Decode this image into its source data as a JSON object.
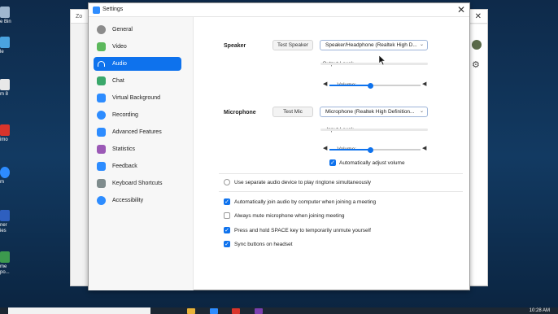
{
  "desktop": {
    "icons": [
      {
        "label": "e Bin"
      },
      {
        "label": "le"
      },
      {
        "label": "m 8"
      },
      {
        "label": "imo"
      },
      {
        "label": "m"
      },
      {
        "label": "ner\nies"
      },
      {
        "label": "me\npo..."
      }
    ]
  },
  "background_window": {
    "title": "Zo"
  },
  "window": {
    "title": "Settings"
  },
  "sidebar": {
    "items": [
      {
        "label": "General",
        "color": "#8c8c8c"
      },
      {
        "label": "Video",
        "color": "#5cb85c"
      },
      {
        "label": "Audio",
        "color": "#ffffff"
      },
      {
        "label": "Chat",
        "color": "#3aa86b"
      },
      {
        "label": "Virtual Background",
        "color": "#2d8cff"
      },
      {
        "label": "Recording",
        "color": "#2d8cff"
      },
      {
        "label": "Advanced Features",
        "color": "#2d8cff"
      },
      {
        "label": "Statistics",
        "color": "#9b59b6"
      },
      {
        "label": "Feedback",
        "color": "#2d8cff"
      },
      {
        "label": "Keyboard Shortcuts",
        "color": "#7f8c8d"
      },
      {
        "label": "Accessibility",
        "color": "#2d8cff"
      }
    ],
    "active_index": 2
  },
  "speaker": {
    "section_label": "Speaker",
    "test_button": "Test Speaker",
    "device": "Speaker/Headphone (Realtek High D...",
    "output_level_label": "Output Level:",
    "volume_label": "Volume:",
    "volume_fraction": 0.45
  },
  "microphone": {
    "section_label": "Microphone",
    "test_button": "Test Mic",
    "device": "Microphone (Realtek High Definition...",
    "input_level_label": "Input Level:",
    "volume_label": "Volume:",
    "volume_fraction": 0.45,
    "auto_adjust_label": "Automatically adjust volume",
    "auto_adjust_checked": true
  },
  "options": {
    "separate_device": {
      "label": "Use separate audio device to play ringtone simultaneously",
      "checked": false
    },
    "auto_join": {
      "label": "Automatically join audio by computer when joining a meeting",
      "checked": true
    },
    "always_mute": {
      "label": "Always mute microphone when joining meeting",
      "checked": false
    },
    "space_unmute": {
      "label": "Press and hold SPACE key to temporarily unmute yourself",
      "checked": true
    },
    "sync_headset": {
      "label": "Sync buttons on headset",
      "checked": true
    }
  },
  "taskbar": {
    "time": "10:28 AM"
  },
  "colors": {
    "accent": "#0e72ed"
  }
}
